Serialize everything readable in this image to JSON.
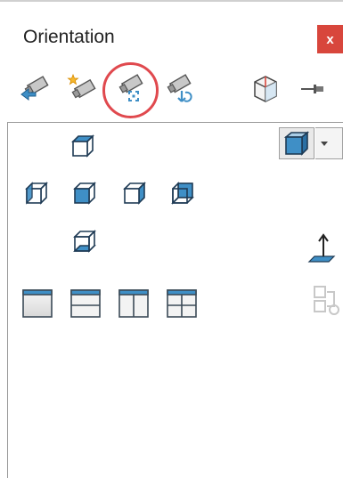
{
  "panel": {
    "title": "Orientation",
    "close_label": "x"
  },
  "toolbar": {
    "icons": [
      "previous-view-icon",
      "new-view-icon",
      "update-standard-views-icon",
      "reset-standard-views-icon",
      "view-selector-icon",
      "pin-icon"
    ],
    "highlighted": "update-standard-views-icon"
  },
  "views": {
    "standard_rows": [
      [
        "top-view-icon"
      ],
      [
        "left-view-icon",
        "front-view-icon",
        "right-view-icon",
        "back-view-icon"
      ],
      [
        "bottom-view-icon"
      ]
    ],
    "multi_view_row": [
      "single-view-icon",
      "two-view-horizontal-icon",
      "two-view-vertical-icon",
      "four-view-icon"
    ],
    "current_view": "isometric-view-icon",
    "side_icons": [
      "normal-to-icon",
      "link-views-icon"
    ]
  },
  "colors": {
    "accent_blue": "#3f8fc6",
    "highlight_red": "#e0494e",
    "close_red": "#d8463c"
  }
}
